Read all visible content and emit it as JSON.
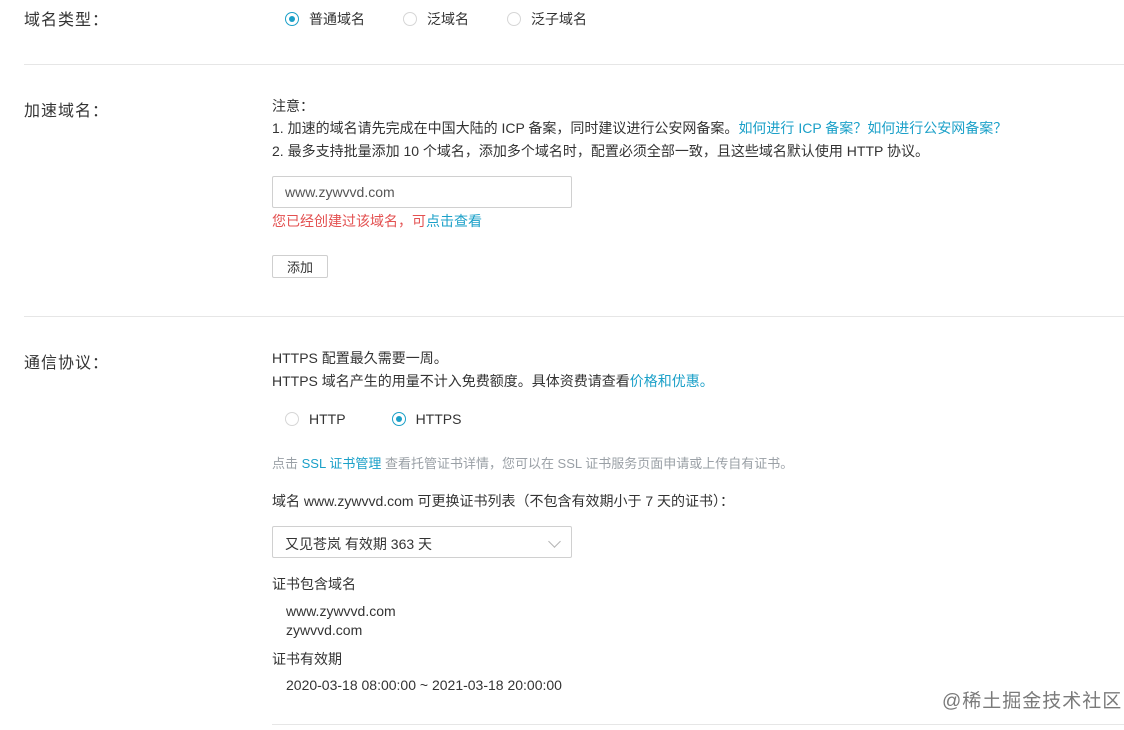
{
  "domain_type": {
    "label": "域名类型：",
    "options": [
      {
        "label": "普通域名",
        "selected": true
      },
      {
        "label": "泛域名",
        "selected": false
      },
      {
        "label": "泛子域名",
        "selected": false
      }
    ]
  },
  "accel_domain": {
    "label": "加速域名：",
    "note_title": "注意：",
    "note_1": "1. 加速的域名请先完成在中国大陆的 ICP 备案，同时建议进行公安网备案。",
    "note_1_link_icp": "如何进行 ICP 备案？",
    "note_1_link_police": "如何进行公安网备案？",
    "note_2": "2. 最多支持批量添加 10 个域名，添加多个域名时，配置必须全部一致，且这些域名默认使用 HTTP 协议。",
    "input_value": "www.zywvvd.com",
    "error_text": "您已经创建过该域名，可",
    "error_link": "点击查看",
    "add_button": "添加"
  },
  "protocol": {
    "label": "通信协议：",
    "info_1": "HTTPS 配置最久需要一周。",
    "info_2": "HTTPS 域名产生的用量不计入免费额度。具体资费请查看",
    "info_2_link": "价格和优惠。",
    "options": [
      {
        "label": "HTTP",
        "selected": false
      },
      {
        "label": "HTTPS",
        "selected": true
      }
    ],
    "ssl_hint_prefix": "点击 ",
    "ssl_hint_link": "SSL 证书管理",
    "ssl_hint_suffix": " 查看托管证书详情，您可以在 SSL 证书服务页面申请或上传自有证书。",
    "cert_list_title": "域名 www.zywvvd.com 可更换证书列表（不包含有效期小于 7 天的证书）：",
    "cert_selected": "又见苍岚 有效期 363 天",
    "cert_domains_title": "证书包含域名",
    "cert_domains": [
      "www.zywvvd.com",
      "zywvvd.com"
    ],
    "cert_validity_title": "证书有效期",
    "cert_validity": "2020-03-18 08:00:00 ~ 2021-03-18 20:00:00"
  },
  "watermark": "@稀土掘金技术社区",
  "colors": {
    "accent": "#1ba0c8",
    "error": "#e35050",
    "muted": "#9aa0a6"
  }
}
